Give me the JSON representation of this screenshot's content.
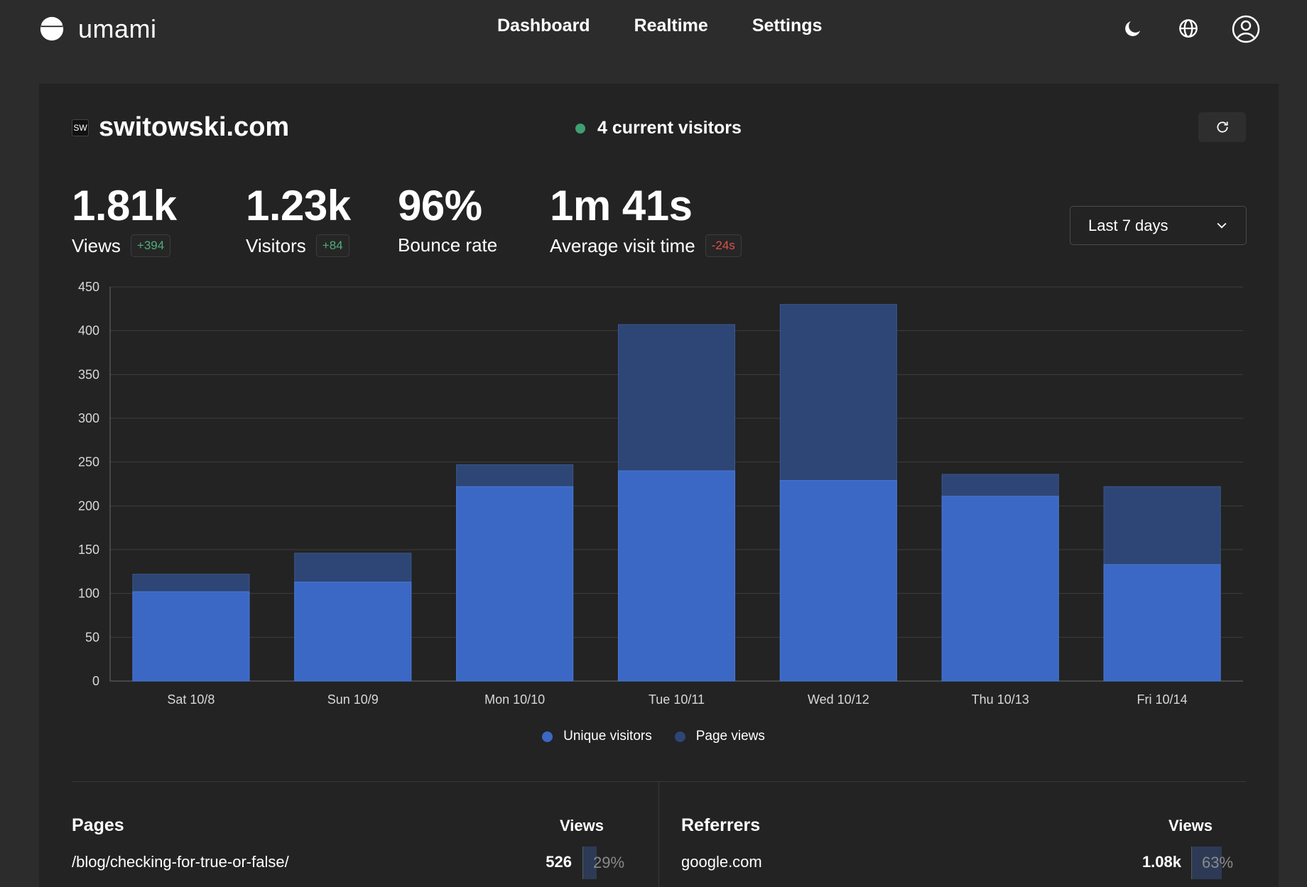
{
  "app": {
    "name": "umami"
  },
  "nav": {
    "items": [
      "Dashboard",
      "Realtime",
      "Settings"
    ]
  },
  "icons": {
    "theme": "moon-icon",
    "language": "globe-icon",
    "profile": "user-icon",
    "refresh": "refresh-icon",
    "dropdown": "chevron-down-icon"
  },
  "site": {
    "favicon_text": "SW",
    "name": "switowski.com",
    "current_visitors": "4 current visitors"
  },
  "metrics": [
    {
      "value": "1.81k",
      "label": "Views",
      "change": "+394",
      "change_type": "positive"
    },
    {
      "value": "1.23k",
      "label": "Visitors",
      "change": "+84",
      "change_type": "positive"
    },
    {
      "value": "96%",
      "label": "Bounce rate",
      "change": "",
      "change_type": "none"
    },
    {
      "value": "1m 41s",
      "label": "Average visit time",
      "change": "-24s",
      "change_type": "negative"
    }
  ],
  "date_range": {
    "selected": "Last 7 days"
  },
  "colors": {
    "unique_visitors": "#3a68c4",
    "page_views": "#2e4675",
    "positive": "#4fae7b",
    "negative": "#e0524a",
    "online": "#3f9e72"
  },
  "chart_data": {
    "type": "bar",
    "stacked": "overlay",
    "categories": [
      "Sat 10/8",
      "Sun 10/9",
      "Mon 10/10",
      "Tue 10/11",
      "Wed 10/12",
      "Thu 10/13",
      "Fri 10/14"
    ],
    "series": [
      {
        "name": "Unique visitors",
        "values": [
          102,
          113,
          222,
          240,
          229,
          211,
          133
        ]
      },
      {
        "name": "Page views",
        "values": [
          122,
          146,
          247,
          407,
          430,
          236,
          222
        ]
      }
    ],
    "yticks": [
      0,
      50,
      100,
      150,
      200,
      250,
      300,
      350,
      400,
      450
    ],
    "ylim": [
      0,
      450
    ],
    "grid": true,
    "legend": "bottom-center"
  },
  "tables": {
    "pages": {
      "title": "Pages",
      "metric_header": "Views",
      "rows": [
        {
          "label": "/blog/checking-for-true-or-false/",
          "value": "526",
          "percent": "29%",
          "share": 0.29
        }
      ]
    },
    "referrers": {
      "title": "Referrers",
      "metric_header": "Views",
      "rows": [
        {
          "label": "google.com",
          "value": "1.08k",
          "percent": "63%",
          "share": 0.63
        }
      ]
    }
  }
}
